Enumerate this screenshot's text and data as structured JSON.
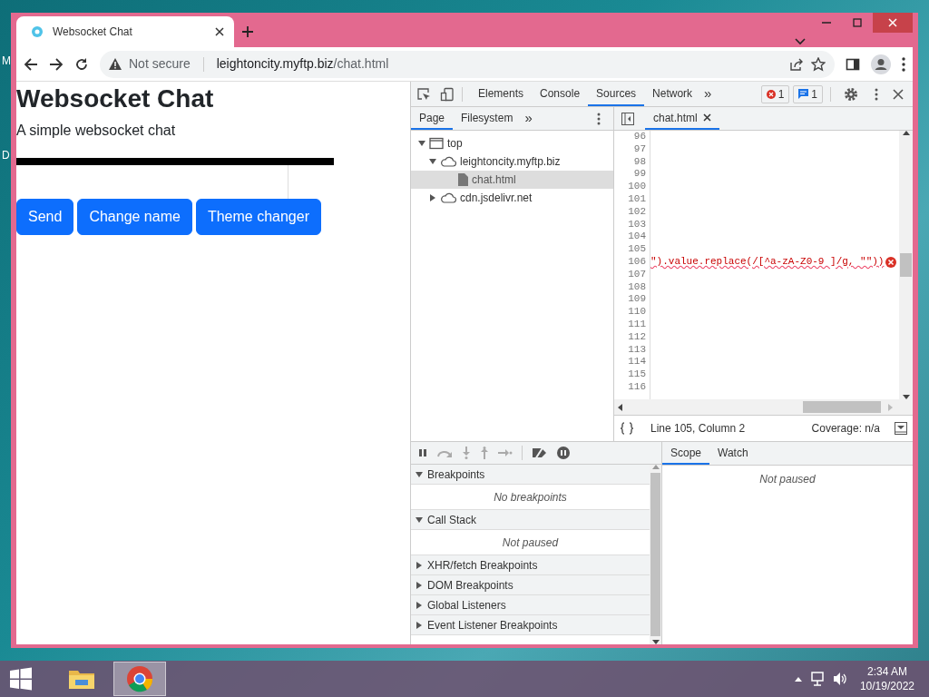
{
  "desktop": {
    "labels": [
      "M",
      "D"
    ]
  },
  "browser": {
    "tabs": [
      {
        "title": "Websocket Chat",
        "selected": true
      }
    ],
    "address": {
      "security": "Not secure",
      "host": "leightoncity.myftp.biz",
      "path": "/chat.html"
    }
  },
  "page": {
    "title": "Websocket Chat",
    "subtitle": "A simple websocket chat",
    "buttons": [
      "Send",
      "Change name",
      "Theme changer"
    ]
  },
  "devtools": {
    "tabs": [
      {
        "label": "Elements",
        "selected": false
      },
      {
        "label": "Console",
        "selected": false
      },
      {
        "label": "Sources",
        "selected": true
      },
      {
        "label": "Network",
        "selected": false
      }
    ],
    "more": "»",
    "errors": "1",
    "messages": "1",
    "navigator": {
      "tabs": [
        {
          "label": "Page",
          "selected": true
        },
        {
          "label": "Filesystem",
          "selected": false
        }
      ],
      "more": "»",
      "tree": [
        {
          "kind": "frame",
          "label": "top",
          "expanded": true,
          "children": [
            {
              "kind": "domain",
              "label": "leightoncity.myftp.biz",
              "expanded": true,
              "children": [
                {
                  "kind": "file",
                  "label": "chat.html",
                  "selected": true
                }
              ]
            },
            {
              "kind": "domain",
              "label": "cdn.jsdelivr.net",
              "expanded": false
            }
          ]
        }
      ]
    },
    "editor": {
      "tabs": [
        {
          "label": "chat.html",
          "selected": true
        }
      ],
      "lines": [
        {
          "number": "96"
        },
        {
          "number": "97"
        },
        {
          "number": "98"
        },
        {
          "number": "99"
        },
        {
          "number": "100"
        },
        {
          "number": "101"
        },
        {
          "number": "102"
        },
        {
          "number": "103"
        },
        {
          "number": "104"
        },
        {
          "number": "105"
        },
        {
          "number": "106",
          "code": "\").value.replace(/[^a-zA-Z0-9 ]/g, \"\"))",
          "error": true
        },
        {
          "number": "107"
        },
        {
          "number": "108"
        },
        {
          "number": "109"
        },
        {
          "number": "110"
        },
        {
          "number": "111"
        },
        {
          "number": "112"
        },
        {
          "number": "113"
        },
        {
          "number": "114"
        },
        {
          "number": "115"
        },
        {
          "number": "116"
        }
      ],
      "position": "Line 105, Column 2",
      "coverage": "Coverage: n/a"
    },
    "debugger": {
      "sections": [
        {
          "label": "Breakpoints",
          "expanded": true,
          "empty": "No breakpoints"
        },
        {
          "label": "Call Stack",
          "expanded": true,
          "empty": "Not paused"
        },
        {
          "label": "XHR/fetch Breakpoints",
          "expanded": false
        },
        {
          "label": "DOM Breakpoints",
          "expanded": false
        },
        {
          "label": "Global Listeners",
          "expanded": false
        },
        {
          "label": "Event Listener Breakpoints",
          "expanded": false
        }
      ],
      "side_tabs": [
        {
          "label": "Scope",
          "selected": true
        },
        {
          "label": "Watch",
          "selected": false
        }
      ],
      "side_empty": "Not paused"
    }
  },
  "taskbar": {
    "apps": [
      {
        "kind": "explorer",
        "selected": false
      },
      {
        "kind": "chrome",
        "selected": true
      }
    ],
    "time": "2:34 AM",
    "date": "10/19/2022"
  }
}
